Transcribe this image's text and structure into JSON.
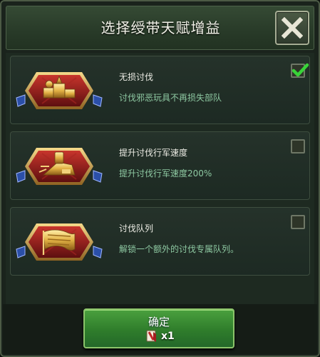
{
  "dialog": {
    "title": "选择绶带天赋增益"
  },
  "options": [
    {
      "title": "无损讨伐",
      "description": "讨伐邪恶玩具不再损失部队",
      "checked": true,
      "emblem_icon": "toy-blocks-emblem-icon"
    },
    {
      "title": "提升讨伐行军速度",
      "description": "提升讨伐行军速度200%",
      "checked": false,
      "emblem_icon": "marching-toy-emblem-icon"
    },
    {
      "title": "讨伐队列",
      "description": "解锁一个额外的讨伐专属队列。",
      "checked": false,
      "emblem_icon": "banner-flag-emblem-icon"
    }
  ],
  "footer": {
    "confirm_label": "确定",
    "cost_icon": "ribbon-item-icon",
    "cost_qty": "x1"
  },
  "colors": {
    "panel_bg": "#1e2a21",
    "header_bg": "#2f432f",
    "description_green": "#8ec9a2",
    "confirm_green": "#2f7d2b",
    "emblem_red": "#8c1c1a",
    "emblem_gold": "#d9a436",
    "check_green": "#3cd43c"
  }
}
